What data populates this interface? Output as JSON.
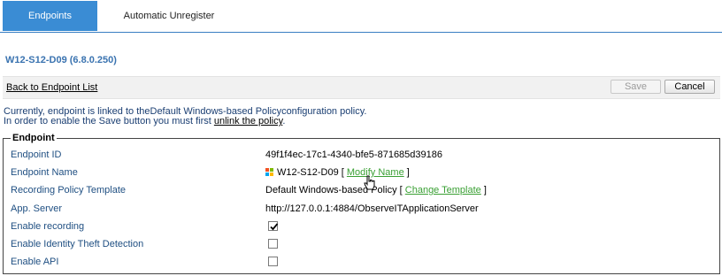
{
  "tabs": [
    {
      "label": "Endpoints",
      "active": true
    },
    {
      "label": "Automatic Unregister",
      "active": false
    }
  ],
  "page_title": "W12-S12-D09 (6.8.0.250)",
  "toolbar": {
    "back_label": "Back to Endpoint List",
    "save_label": "Save",
    "cancel_label": "Cancel"
  },
  "info": {
    "line1": "Currently, endpoint is linked to theDefault Windows-based Policyconfiguration policy.",
    "line2_prefix": "In order to enable the Save button you must first ",
    "line2_link": "unlink the policy",
    "line2_suffix": "."
  },
  "endpoint": {
    "legend": "Endpoint",
    "endpoint_id": {
      "label": "Endpoint ID",
      "value": "49f1f4ec-17c1-4340-bfe5-871685d39186"
    },
    "endpoint_name": {
      "label": "Endpoint Name",
      "value": "W12-S12-D09",
      "open_bracket": "[",
      "link": "Modify Name",
      "close_bracket": "]",
      "icon": "windows-logo-icon"
    },
    "recording_policy": {
      "label": "Recording Policy Template",
      "value": "Default Windows-based Policy",
      "open_bracket": "[",
      "link": "Change Template",
      "close_bracket": "]"
    },
    "app_server": {
      "label": "App. Server",
      "value": "http://127.0.0.1:4884/ObserveITApplicationServer"
    },
    "enable_recording": {
      "label": "Enable recording",
      "checked": true
    },
    "enable_identity_theft": {
      "label": "Enable Identity Theft Detection",
      "checked": false
    },
    "enable_api": {
      "label": "Enable API",
      "checked": false
    }
  },
  "colors": {
    "accent": "#3a8cd4",
    "title": "#3a73b0",
    "label": "#1f4f82",
    "link_green": "#3aa034"
  }
}
